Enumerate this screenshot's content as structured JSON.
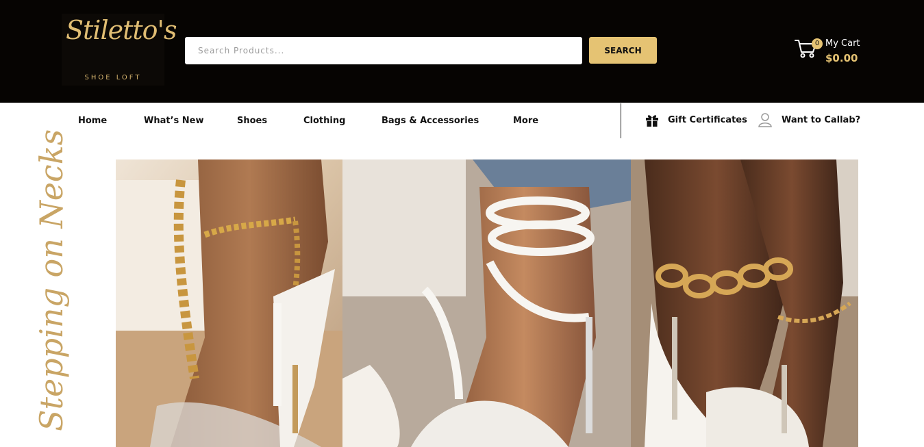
{
  "brand": {
    "logo_text": "Stiletto's",
    "logo_subtitle": "SHOE LOFT"
  },
  "search": {
    "placeholder": "Search Products...",
    "button_label": "SEARCH"
  },
  "cart": {
    "count": "0",
    "label": "My Cart",
    "total": "$0.00"
  },
  "nav": {
    "items": [
      "Home",
      "What’s New",
      "Shoes",
      "Clothing",
      "Bags & Accessories",
      "More"
    ]
  },
  "utility": {
    "gift_label": "Gift Certificates",
    "collab_label": "Want to Callab?"
  },
  "hero": {
    "vertical_text": "Stepping on Necks"
  },
  "icons": {
    "cart": "cart-icon",
    "gift": "gift-icon",
    "collab": "user-icon"
  },
  "colors": {
    "header_bg": "#060402",
    "accent_gold": "#e5c373"
  }
}
